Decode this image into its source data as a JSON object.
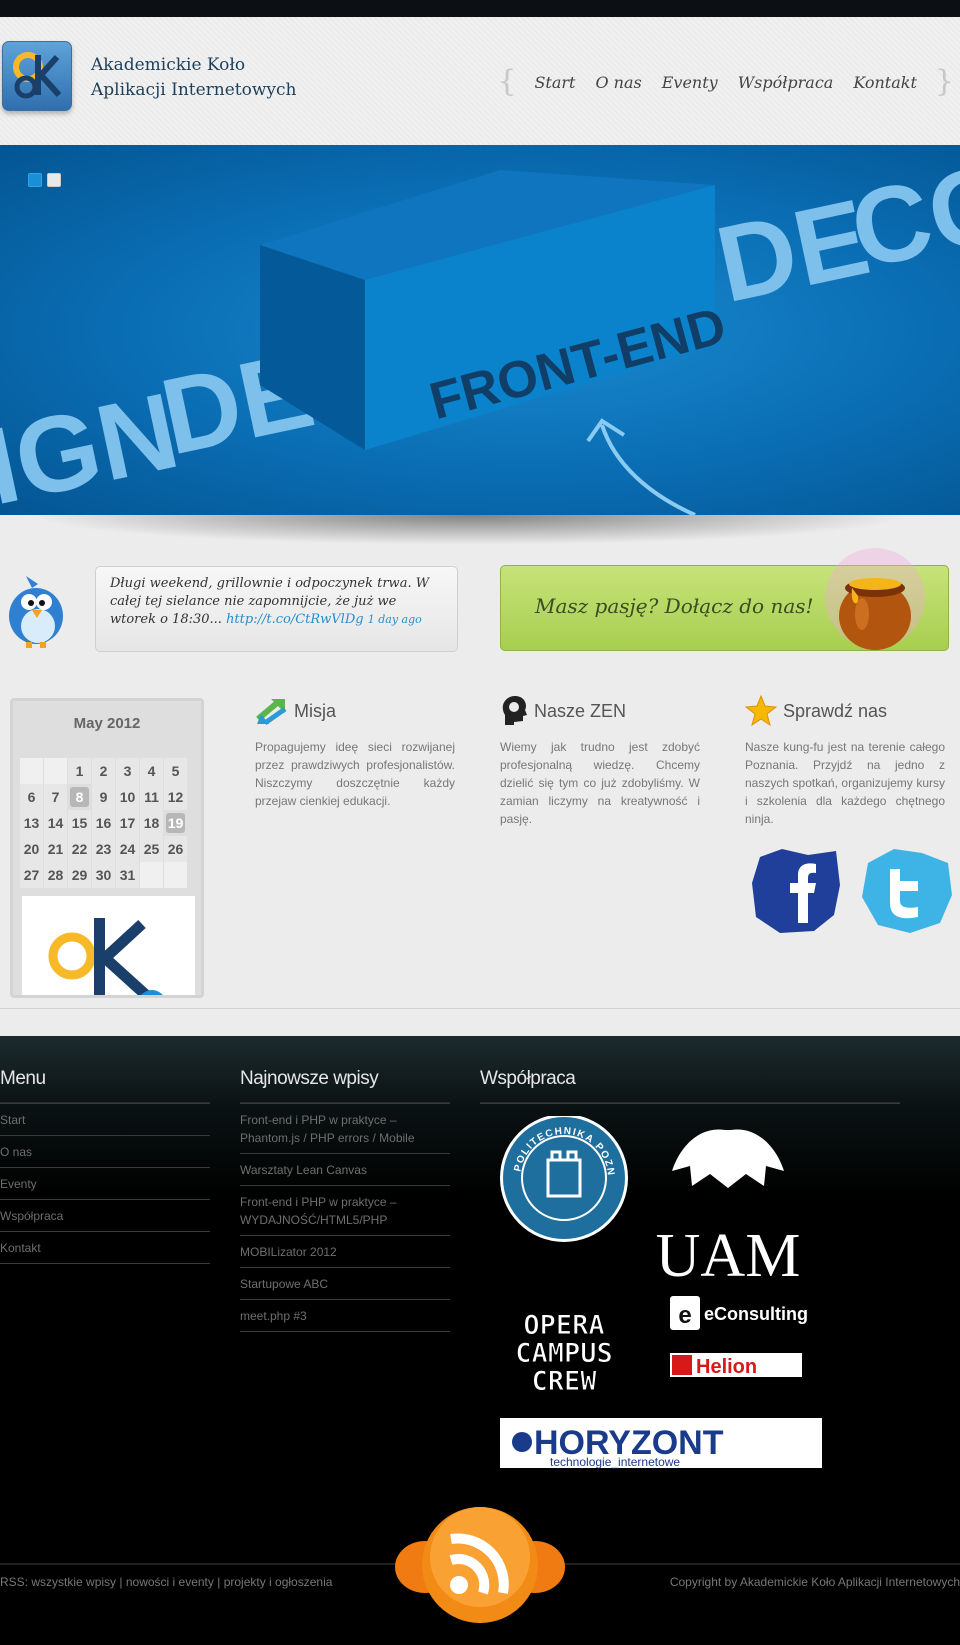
{
  "header": {
    "brand_line1": "Akademickie Koło",
    "brand_line2": "Aplikacji Internetowych",
    "nav": [
      "Start",
      "O nas",
      "Eventy",
      "Współpraca",
      "Kontakt"
    ]
  },
  "slider": {
    "words": [
      "IGN",
      "DESIG",
      "FRONT-END",
      "DE",
      "CO"
    ],
    "active_slide": 1,
    "slide_count": 2
  },
  "tweet": {
    "text": "Długi weekend, grillownie i odpoczynek trwa. W całej tej sielance nie zapomnijcie, że już we wtorek o 18:30...",
    "link": "http://t.co/CtRwVlDg",
    "time": "1 day ago"
  },
  "join": {
    "label": "Masz pasję? Dołącz do nas!"
  },
  "calendar": {
    "title": "May 2012",
    "rows": [
      [
        "",
        "",
        "1",
        "2",
        "3",
        "4",
        "5"
      ],
      [
        "6",
        "7",
        "8",
        "9",
        "10",
        "11",
        "12"
      ],
      [
        "13",
        "14",
        "15",
        "16",
        "17",
        "18",
        "19"
      ],
      [
        "20",
        "21",
        "22",
        "23",
        "24",
        "25",
        "26"
      ],
      [
        "27",
        "28",
        "29",
        "30",
        "31",
        "",
        ""
      ]
    ],
    "highlighted": [
      "8",
      "19"
    ]
  },
  "columns": [
    {
      "title": "Misja",
      "text": "Propagujemy ideę sieci rozwijanej przez prawdziwych profesjonalistów. Niszczymy doszczętnie każdy przejaw cienkiej edukacji.",
      "icon": "arrows-icon"
    },
    {
      "title": "Nasze ZEN",
      "text": "Wiemy jak trudno jest zdobyć profesjonalną wiedzę. Chcemy dzielić się tym co już zdobyliśmy. W zamian liczymy na kreatywność i pasję.",
      "icon": "head-icon"
    },
    {
      "title": "Sprawdź nas",
      "text": "Nasze kung-fu jest na terenie całego Poznania. Przyjdź na jedno z naszych spotkań, organizujemy kursy i szkolenia dla każdego chętnego ninja.",
      "icon": "star-icon"
    }
  ],
  "footer": {
    "menu_title": "Menu",
    "menu": [
      "Start",
      "O nas",
      "Eventy",
      "Współpraca",
      "Kontakt"
    ],
    "posts_title": "Najnowsze wpisy",
    "posts": [
      "Front-end i PHP w praktyce – Phantom.js / PHP errors / Mobile",
      "Warsztaty Lean Canvas",
      "Front-end i PHP w praktyce – WYDAJNOŚĆ/HTML5/PHP",
      "MOBILizator 2012",
      "Startupowe ABC",
      "meet.php #3"
    ],
    "partners_title": "Współpraca",
    "partners": {
      "politechnika": "POLITECHNIKA POZNAŃSKA",
      "uam": "UAM",
      "opera": [
        "OPERA",
        "CAMPUS",
        "CREW"
      ],
      "econsulting": "eConsulting",
      "helion": "Helion",
      "horyzont": "HORYZONT",
      "horyzont_sub": "technologie_internetowe"
    },
    "rss_prefix": "RSS:",
    "rss_links": [
      "wszystkie wpisy",
      "nowości i eventy",
      "projekty i ogłoszenia"
    ],
    "copyright": "Copyright by Akademickie Koło Aplikacji Internetowych"
  },
  "colors": {
    "accent_blue": "#1a8ed6",
    "join_green": "#b5d866",
    "footer_bg": "#000000"
  }
}
